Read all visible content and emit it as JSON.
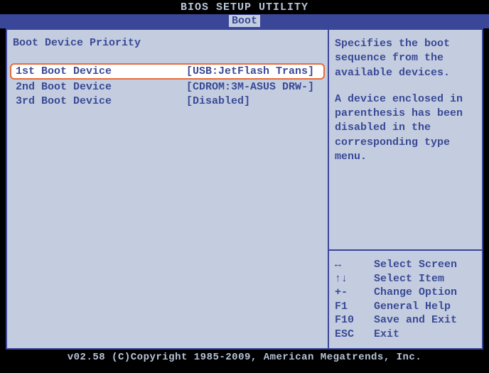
{
  "header": {
    "title": "BIOS SETUP UTILITY",
    "active_tab": "Boot"
  },
  "main": {
    "panel_title": "Boot Device Priority",
    "items": [
      {
        "label": "1st Boot Device",
        "value": "[USB:JetFlash Trans]",
        "selected": true
      },
      {
        "label": "2nd Boot Device",
        "value": "[CDROM:3M-ASUS DRW-]",
        "selected": false
      },
      {
        "label": "3rd Boot Device",
        "value": "[Disabled]",
        "selected": false
      }
    ]
  },
  "help": {
    "text1": "Specifies the boot sequence from the available devices.",
    "text2": "A device enclosed in parenthesis has been disabled in the corresponding type menu."
  },
  "hints": [
    {
      "key": "↔",
      "label": "Select Screen"
    },
    {
      "key": "↑↓",
      "label": "Select Item"
    },
    {
      "key": "+-",
      "label": "Change Option"
    },
    {
      "key": "F1",
      "label": "General Help"
    },
    {
      "key": "F10",
      "label": "Save and Exit"
    },
    {
      "key": "ESC",
      "label": "Exit"
    }
  ],
  "footer": {
    "text": "v02.58 (C)Copyright 1985-2009, American Megatrends, Inc."
  }
}
